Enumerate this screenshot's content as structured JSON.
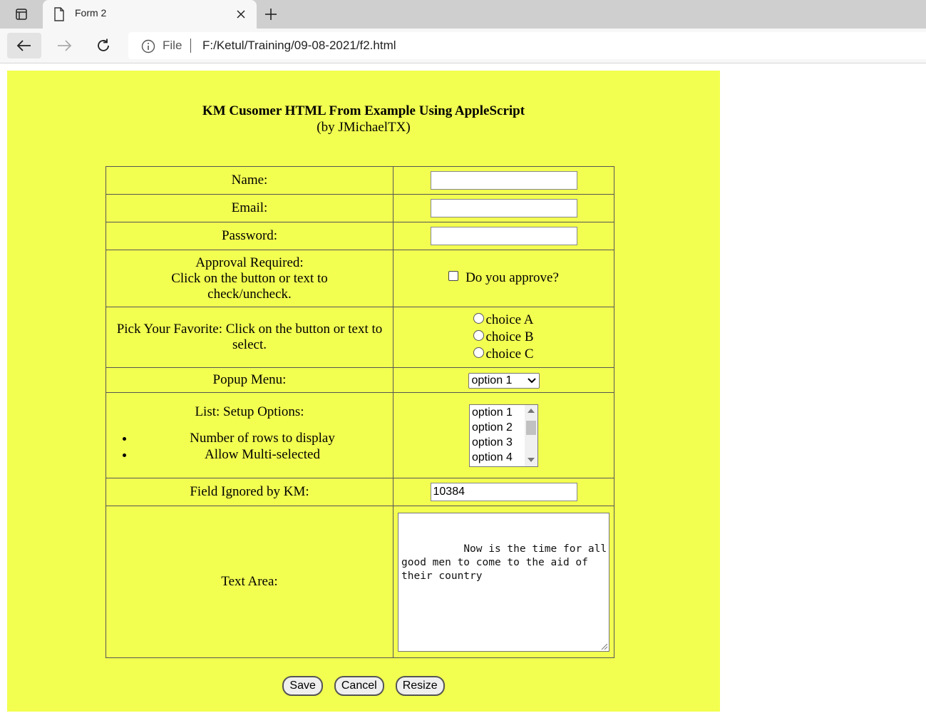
{
  "browser": {
    "tab_title": "Form 2",
    "address_scheme": "File",
    "address_url": "F:/Ketul/Training/09-08-2021/f2.html"
  },
  "form": {
    "title": "KM Cusomer HTML From Example Using AppleScript",
    "subtitle": "(by JMichaelTX)",
    "name_label": "Name:",
    "name_value": "",
    "email_label": "Email:",
    "email_value": "",
    "password_label": "Password:",
    "password_value": "",
    "approval_label_line1": "Approval Required:",
    "approval_label_line2": "Click on the button or text to check/uncheck.",
    "approval_checkbox_label": "Do you approve?",
    "approval_checked": false,
    "favorite_label": "Pick Your Favorite: Click on the button or text to select.",
    "radio_options": [
      "choice A",
      "choice B",
      "choice C"
    ],
    "popup_label": "Popup Menu:",
    "popup_selected": "option 1",
    "list_label": "List: Setup Options:",
    "list_bullets": [
      "Number of rows to display",
      "Allow Multi-selected"
    ],
    "list_options": [
      "option 1",
      "option 2",
      "option 3",
      "option 4"
    ],
    "ignored_label": "Field Ignored by KM:",
    "ignored_value": "10384",
    "textarea_label": "Text Area:",
    "textarea_value": "Now is the time for all good men to come to the aid of their country",
    "buttons": {
      "save": "Save",
      "cancel": "Cancel",
      "resize": "Resize"
    }
  },
  "colors": {
    "page_background": "#f2ff50"
  }
}
